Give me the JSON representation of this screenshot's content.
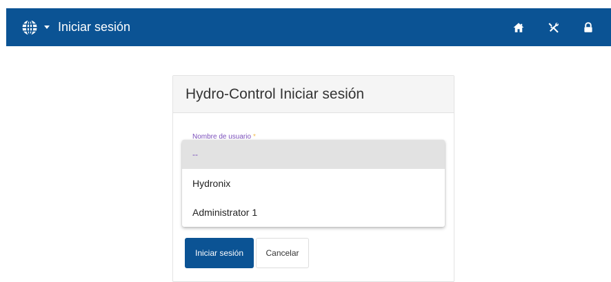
{
  "navbar": {
    "title": "Iniciar sesión",
    "language_icon": "globe-icon",
    "right_icons": [
      "home-icon",
      "tools-icon",
      "lock-icon"
    ],
    "background": "#0b5394"
  },
  "card": {
    "title": "Hydro-Control Iniciar sesión"
  },
  "username_field": {
    "label": "Nombre de usuario",
    "required_mark": "*",
    "options": [
      "--",
      "Hydronix",
      "Administrator 1"
    ],
    "selected": "--"
  },
  "actions": {
    "login_label": "Iniciar sesión",
    "cancel_label": "Cancelar"
  }
}
